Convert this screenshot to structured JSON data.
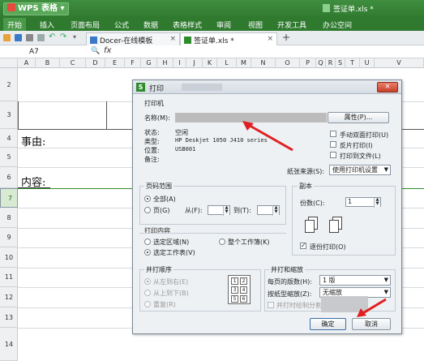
{
  "title_bar": {
    "app_name": "WPS 表格",
    "dropdown_arrow": "▾",
    "doc_title": "签证单.xls *"
  },
  "menu": {
    "items": [
      "开始",
      "插入",
      "页面布局",
      "公式",
      "数据",
      "表格样式",
      "审阅",
      "视图",
      "开发工具",
      "办公空间"
    ]
  },
  "tabs": [
    {
      "label": "Docer-在线模板",
      "close": "×"
    },
    {
      "label": "签证单.xls *",
      "close": "×"
    }
  ],
  "new_tab": "+",
  "formula_bar": {
    "cell_ref": "A7",
    "zoom_symbol": "🔍",
    "fx": "fx"
  },
  "columns": [
    "A",
    "B",
    "C",
    "D",
    "E",
    "F",
    "G",
    "H",
    "I",
    "J",
    "K",
    "L",
    "M",
    "N",
    "O",
    "P",
    "Q",
    "R",
    "S",
    "T",
    "U",
    "V"
  ],
  "rows": [
    "2",
    "3",
    "4",
    "5",
    "6",
    "7",
    "8",
    "9",
    "10",
    "11",
    "12",
    "13",
    "14"
  ],
  "cells": {
    "reason_label": "事由:",
    "content_label": "内容:"
  },
  "dialog": {
    "title": "打印",
    "close": "×",
    "printer": {
      "group_label": "打印机",
      "name_label": "名称(M):",
      "properties_button": "属性(P)...",
      "status_label": "状态:",
      "status_value": "空闲",
      "type_label": "类型:",
      "type_value": "HP Deskjet 1050 J410 series",
      "location_label": "位置:",
      "location_value": "USB001",
      "note_label": "备注:",
      "manual_duplex": "手动双面打印(U)",
      "reverse_print": "反片打印(I)",
      "print_to_file": "打印到文件(L)",
      "paper_source_label": "纸张来源(S):",
      "paper_source_value": "使用打印机设置"
    },
    "page_range": {
      "group_label": "页码范围",
      "all_label": "全部(A)",
      "pages_label": "页(G)",
      "from_label": "从(F):",
      "to_label": "到(T):"
    },
    "copies": {
      "group_label": "副本",
      "copies_label": "份数(C):",
      "copies_value": "1",
      "collate_label": "逐份打印(O)"
    },
    "print_content": {
      "group_label": "打印内容",
      "selection_label": "选定区域(N)",
      "whole_workbook_label": "整个工作簿(K)",
      "selected_sheet_label": "选定工作表(V)"
    },
    "print_order": {
      "group_label": "并打顺序",
      "left_to_right": "从左到右(E)",
      "top_to_bottom": "从上到下(B)",
      "repeat": "重复(R)",
      "grid_numbers": [
        "1",
        "2",
        "3",
        "4",
        "5",
        "6"
      ]
    },
    "scaling": {
      "group_label": "并打和缩放",
      "pages_per_sheet_label": "每页的版数(H):",
      "pages_per_sheet_value": "1 版",
      "scale_to_paper_label": "按纸型缩放(Z):",
      "scale_to_paper_value": "无缩放",
      "draw_separator_label": "并打时绘制分割线(D)"
    },
    "ok_button": "确定",
    "cancel_button": "取消"
  }
}
